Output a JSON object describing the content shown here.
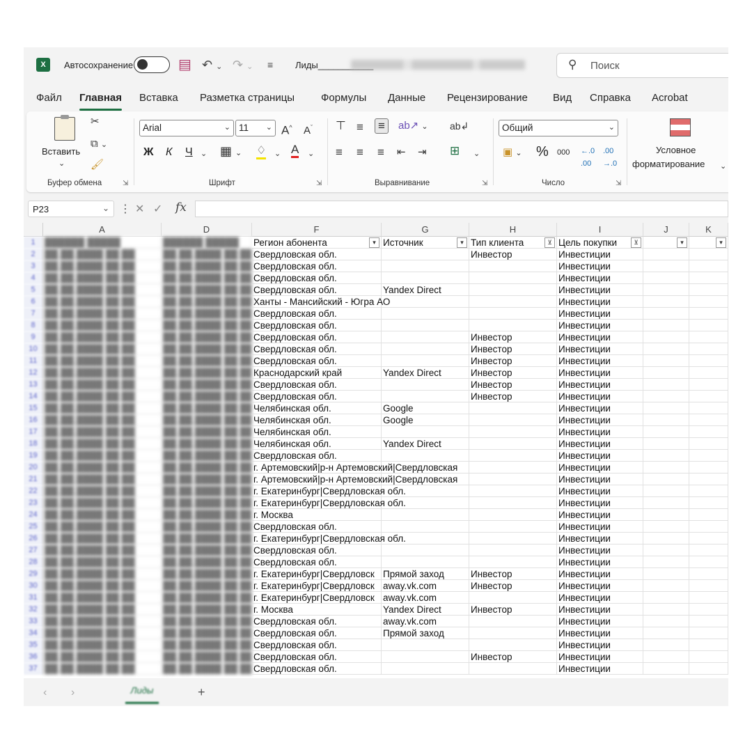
{
  "titlebar": {
    "autosave_label": "Автосохранение",
    "filename": "Лиды___________"
  },
  "search": {
    "placeholder": "Поиск"
  },
  "menu_tabs": [
    "Файл",
    "Главная",
    "Вставка",
    "Разметка страницы",
    "Формулы",
    "Данные",
    "Рецензирование",
    "Вид",
    "Справка",
    "Acrobat"
  ],
  "ribbon": {
    "paste_label": "Вставить",
    "clipboard_group": "Буфер обмена",
    "font_name": "Arial",
    "font_size": "11",
    "bold": "Ж",
    "italic": "К",
    "underline": "Ч",
    "font_group": "Шрифт",
    "align_group": "Выравнивание",
    "number_format": "Общий",
    "percent": "%",
    "thousands": "000",
    "number_group": "Число",
    "cond_format_line1": "Условное",
    "cond_format_line2": "форматирование"
  },
  "formula_bar": {
    "name_box": "P23",
    "fx": "fx"
  },
  "columns": [
    "A",
    "D",
    "F",
    "G",
    "H",
    "I",
    "J",
    "K"
  ],
  "header_row": {
    "F": "Регион абонента",
    "G": "Источник",
    "H": "Тип клиента",
    "I": "Цель покупки"
  },
  "rows": [
    [
      "Свердловская обл.",
      "",
      "Инвестор",
      "Инвестиции"
    ],
    [
      "Свердловская обл.",
      "",
      "",
      "Инвестиции"
    ],
    [
      "Свердловская обл.",
      "",
      "",
      "Инвестиции"
    ],
    [
      "Свердловская обл.",
      "Yandex Direct",
      "",
      "Инвестиции"
    ],
    [
      "Ханты - Мансийский - Югра АО",
      "",
      "",
      "Инвестиции"
    ],
    [
      "Свердловская обл.",
      "",
      "",
      "Инвестиции"
    ],
    [
      "Свердловская обл.",
      "",
      "",
      "Инвестиции"
    ],
    [
      "Свердловская обл.",
      "",
      "Инвестор",
      "Инвестиции"
    ],
    [
      "Свердловская обл.",
      "",
      "Инвестор",
      "Инвестиции"
    ],
    [
      "Свердловская обл.",
      "",
      "Инвестор",
      "Инвестиции"
    ],
    [
      "Краснодарский край",
      "Yandex Direct",
      "Инвестор",
      "Инвестиции"
    ],
    [
      "Свердловская обл.",
      "",
      "Инвестор",
      "Инвестиции"
    ],
    [
      "Свердловская обл.",
      "",
      "Инвестор",
      "Инвестиции"
    ],
    [
      "Челябинская обл.",
      "Google",
      "",
      "Инвестиции"
    ],
    [
      "Челябинская обл.",
      "Google",
      "",
      "Инвестиции"
    ],
    [
      "Челябинская обл.",
      "",
      "",
      "Инвестиции"
    ],
    [
      "Челябинская обл.",
      "Yandex Direct",
      "",
      "Инвестиции"
    ],
    [
      "Свердловская обл.",
      "",
      "",
      "Инвестиции"
    ],
    [
      "г. Артемовский|р-н Артемовский|Свердловская",
      "",
      "",
      "Инвестиции"
    ],
    [
      "г. Артемовский|р-н Артемовский|Свердловская",
      "",
      "",
      "Инвестиции"
    ],
    [
      "г. Екатеринбург|Свердловская обл.",
      "",
      "",
      "Инвестиции"
    ],
    [
      "г. Екатеринбург|Свердловская обл.",
      "",
      "",
      "Инвестиции"
    ],
    [
      "г. Москва",
      "",
      "",
      "Инвестиции"
    ],
    [
      "Свердловская обл.",
      "",
      "",
      "Инвестиции"
    ],
    [
      "г. Екатеринбург|Свердловская обл.",
      "",
      "",
      "Инвестиции"
    ],
    [
      "Свердловская обл.",
      "",
      "",
      "Инвестиции"
    ],
    [
      "Свердловская обл.",
      "",
      "",
      "Инвестиции"
    ],
    [
      "г. Екатеринбург|Свердловск",
      "Прямой заход",
      "Инвестор",
      "Инвестиции"
    ],
    [
      "г. Екатеринбург|Свердловск",
      "away.vk.com",
      "Инвестор",
      "Инвестиции"
    ],
    [
      "г. Екатеринбург|Свердловск",
      "away.vk.com",
      "",
      "Инвестиции"
    ],
    [
      "г. Москва",
      "Yandex Direct",
      "Инвестор",
      "Инвестиции"
    ],
    [
      "Свердловская обл.",
      "away.vk.com",
      "",
      "Инвестиции"
    ],
    [
      "Свердловская обл.",
      "Прямой заход",
      "",
      "Инвестиции"
    ],
    [
      "Свердловская обл.",
      "",
      "",
      "Инвестиции"
    ],
    [
      "Свердловская обл.",
      "",
      "Инвестор",
      "Инвестиции"
    ],
    [
      "Свердловская обл.",
      "",
      "",
      "Инвестиции"
    ]
  ],
  "sheet_tab": "Лиды",
  "colors": {
    "accent": "#1d6f42",
    "filter_active": "#333333"
  },
  "icons": [
    "excel-logo-icon",
    "save-icon",
    "undo-icon",
    "redo-icon",
    "search-icon",
    "paste-icon",
    "filter-dropdown-icon"
  ]
}
